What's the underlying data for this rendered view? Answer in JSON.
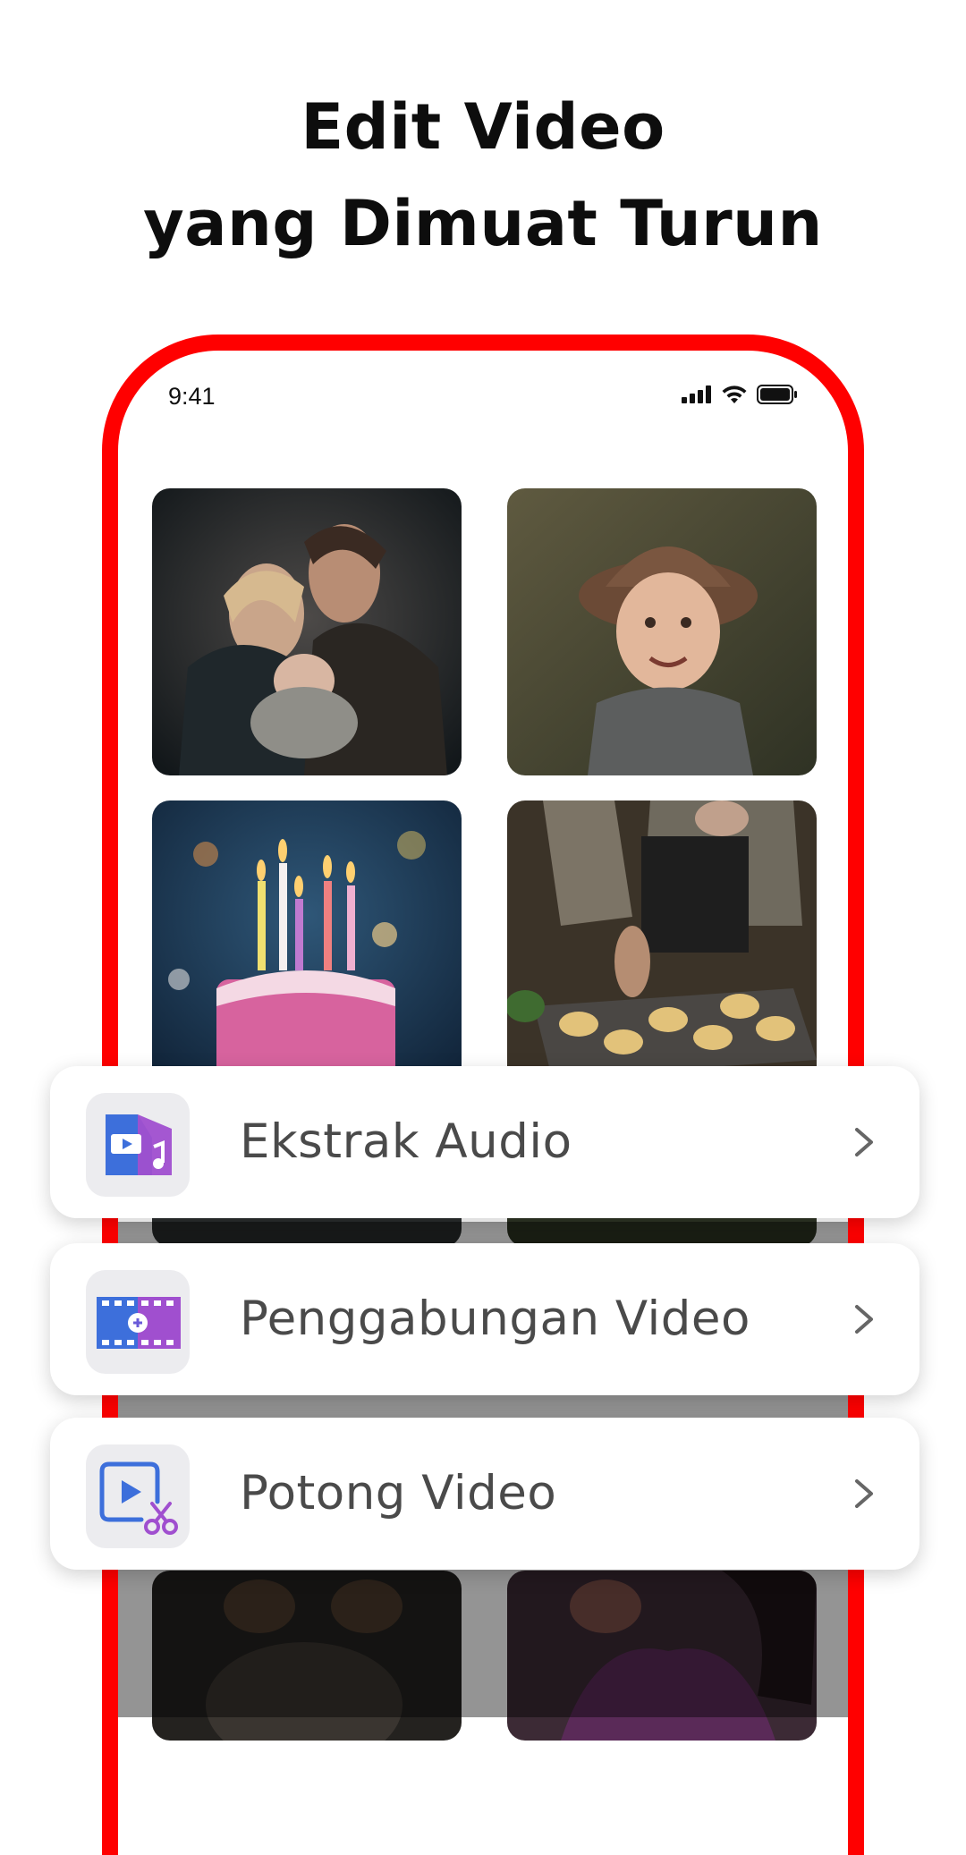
{
  "headline": {
    "line1": "Edit Video",
    "line2": "yang Dimuat Turun"
  },
  "status_bar": {
    "time": "9:41",
    "icons": [
      "signal-icon",
      "wifi-icon",
      "battery-icon"
    ]
  },
  "gallery": {
    "thumbnails": [
      {
        "subject": "family-photo"
      },
      {
        "subject": "child-in-hat-photo"
      },
      {
        "subject": "birthday-cake-photo"
      },
      {
        "subject": "baker-muffins-photo"
      },
      {
        "subject": "dark-photo"
      },
      {
        "subject": "woman-photo"
      }
    ]
  },
  "features": [
    {
      "label": "Ekstrak Audio",
      "icon": "extract-audio-icon"
    },
    {
      "label": "Penggabungan Video",
      "icon": "merge-video-icon"
    },
    {
      "label": "Potong Video",
      "icon": "cut-video-icon"
    }
  ],
  "colors": {
    "frame": "#ff0000",
    "card_bg": "#ffffff",
    "icon_box_bg": "#ececef",
    "blue_accent": "#3d6fdb",
    "purple_accent": "#a04fcf"
  }
}
